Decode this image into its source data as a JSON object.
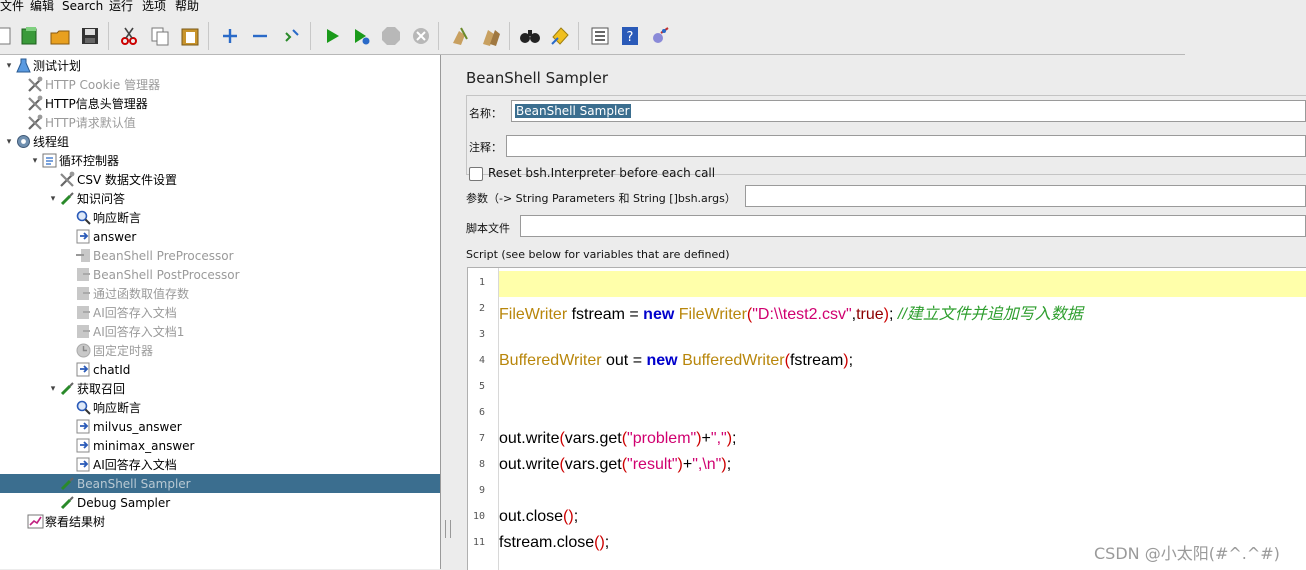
{
  "menu": [
    "文件",
    "编辑",
    "Search",
    "运行",
    "选项",
    "帮助"
  ],
  "toolbar": {
    "icons": [
      "new-icon",
      "templates-icon",
      "open-icon",
      "save-icon",
      "cut-icon",
      "copy-icon",
      "paste-icon",
      "expand-icon",
      "collapse-icon",
      "toggle-icon",
      "start-icon",
      "start-no-pause-icon",
      "stop-icon",
      "shutdown-icon",
      "clear-icon",
      "clear-all-icon",
      "search-icon",
      "reset-search-icon",
      "function-helper-icon",
      "help-icon",
      "remote-icon"
    ]
  },
  "tree": {
    "items": [
      {
        "label": "测试计划",
        "icon": "flask-icon",
        "disabled": false
      },
      {
        "label": "HTTP Cookie 管理器",
        "icon": "tools-icon",
        "disabled": true
      },
      {
        "label": "HTTP信息头管理器",
        "icon": "tools-icon",
        "disabled": false
      },
      {
        "label": "HTTP请求默认值",
        "icon": "tools-icon",
        "disabled": true
      },
      {
        "label": "线程组",
        "icon": "gear-icon",
        "disabled": false
      },
      {
        "label": "循环控制器",
        "icon": "controller-icon",
        "disabled": false
      },
      {
        "label": "CSV 数据文件设置",
        "icon": "tools-icon",
        "disabled": false
      },
      {
        "label": "知识问答",
        "icon": "pipette-icon",
        "disabled": false
      },
      {
        "label": "响应断言",
        "icon": "magnifier-icon",
        "disabled": false
      },
      {
        "label": "answer",
        "icon": "extractor-icon",
        "disabled": false
      },
      {
        "label": "BeanShell PreProcessor",
        "icon": "preprocessor-icon",
        "disabled": true
      },
      {
        "label": "BeanShell PostProcessor",
        "icon": "postprocessor-icon",
        "disabled": true
      },
      {
        "label": "通过函数取值存数",
        "icon": "postprocessor-icon",
        "disabled": true
      },
      {
        "label": "AI回答存入文档",
        "icon": "postprocessor-icon",
        "disabled": true
      },
      {
        "label": "AI回答存入文档1",
        "icon": "postprocessor-icon",
        "disabled": true
      },
      {
        "label": "固定定时器",
        "icon": "timer-icon",
        "disabled": true
      },
      {
        "label": "chatId",
        "icon": "extractor-icon",
        "disabled": false
      },
      {
        "label": "获取召回",
        "icon": "pipette-icon",
        "disabled": false
      },
      {
        "label": "响应断言",
        "icon": "magnifier-icon",
        "disabled": false
      },
      {
        "label": "milvus_answer",
        "icon": "extractor-icon",
        "disabled": false
      },
      {
        "label": "minimax_answer",
        "icon": "extractor-icon",
        "disabled": false
      },
      {
        "label": "AI回答存入文档",
        "icon": "extractor-icon",
        "disabled": false
      },
      {
        "label": "BeanShell Sampler",
        "icon": "pipette-icon",
        "disabled": true
      },
      {
        "label": "Debug Sampler",
        "icon": "pipette-icon",
        "disabled": false
      },
      {
        "label": "察看结果树",
        "icon": "chart-icon",
        "disabled": false
      }
    ]
  },
  "panel": {
    "title": "BeanShell Sampler",
    "name_label": "名称：",
    "name_value": "BeanShell Sampler",
    "comment_label": "注释：",
    "comment_value": "",
    "reset_label": "Reset bsh.Interpreter before each call",
    "params_label": "参数（-> String Parameters 和 String []bsh.args）",
    "params_value": "",
    "file_label": "脚本文件",
    "file_value": "",
    "script_label": "Script (see below for variables that are defined)"
  },
  "script": {
    "line_numbers": [
      "1",
      "2",
      "3",
      "4",
      "5",
      "6",
      "7",
      "8",
      "9",
      "10",
      "11"
    ],
    "lines": [
      [],
      [
        {
          "t": "FileWriter",
          "c": "t-type"
        },
        {
          "t": " fstream ",
          "c": "t-pl"
        },
        {
          "t": "=",
          "c": "t-pl"
        },
        {
          "t": " new ",
          "c": "t-kw"
        },
        {
          "t": "FileWriter",
          "c": "t-type"
        },
        {
          "t": "(",
          "c": "t-par"
        },
        {
          "t": "\"D:\\\\test2.csv\"",
          "c": "t-str"
        },
        {
          "t": ",",
          "c": "t-pl"
        },
        {
          "t": "true",
          "c": "t-bool"
        },
        {
          "t": ")",
          "c": "t-par"
        },
        {
          "t": "; ",
          "c": "t-pl"
        },
        {
          "t": "//建立文件并追加写入数据",
          "c": "t-cm"
        }
      ],
      [],
      [
        {
          "t": "BufferedWriter",
          "c": "t-type"
        },
        {
          "t": " out ",
          "c": "t-pl"
        },
        {
          "t": "=",
          "c": "t-pl"
        },
        {
          "t": " new ",
          "c": "t-kw"
        },
        {
          "t": "BufferedWriter",
          "c": "t-type"
        },
        {
          "t": "(",
          "c": "t-par"
        },
        {
          "t": "fstream",
          "c": "t-pl"
        },
        {
          "t": ")",
          "c": "t-par"
        },
        {
          "t": ";",
          "c": "t-pl"
        }
      ],
      [],
      [],
      [
        {
          "t": "out.write",
          "c": "t-pl"
        },
        {
          "t": "(",
          "c": "t-par"
        },
        {
          "t": "vars.get",
          "c": "t-pl"
        },
        {
          "t": "(",
          "c": "t-par"
        },
        {
          "t": "\"problem\"",
          "c": "t-str"
        },
        {
          "t": ")",
          "c": "t-par"
        },
        {
          "t": "+",
          "c": "t-pl"
        },
        {
          "t": "\",\"",
          "c": "t-str"
        },
        {
          "t": ")",
          "c": "t-par"
        },
        {
          "t": ";",
          "c": "t-pl"
        }
      ],
      [
        {
          "t": "out.write",
          "c": "t-pl"
        },
        {
          "t": "(",
          "c": "t-par"
        },
        {
          "t": "vars.get",
          "c": "t-pl"
        },
        {
          "t": "(",
          "c": "t-par"
        },
        {
          "t": "\"result\"",
          "c": "t-str"
        },
        {
          "t": ")",
          "c": "t-par"
        },
        {
          "t": "+",
          "c": "t-pl"
        },
        {
          "t": "\",\\n\"",
          "c": "t-str"
        },
        {
          "t": ")",
          "c": "t-par"
        },
        {
          "t": ";",
          "c": "t-pl"
        }
      ],
      [],
      [
        {
          "t": "out.close",
          "c": "t-pl"
        },
        {
          "t": "()",
          "c": "t-par"
        },
        {
          "t": ";",
          "c": "t-pl"
        }
      ],
      [
        {
          "t": "fstream.close",
          "c": "t-pl"
        },
        {
          "t": "()",
          "c": "t-par"
        },
        {
          "t": ";",
          "c": "t-pl"
        }
      ]
    ]
  },
  "watermark": "CSDN @小太阳(#^.^#)",
  "colors": {
    "selection": "#3b6e8f",
    "current_line": "#ffffaa"
  }
}
